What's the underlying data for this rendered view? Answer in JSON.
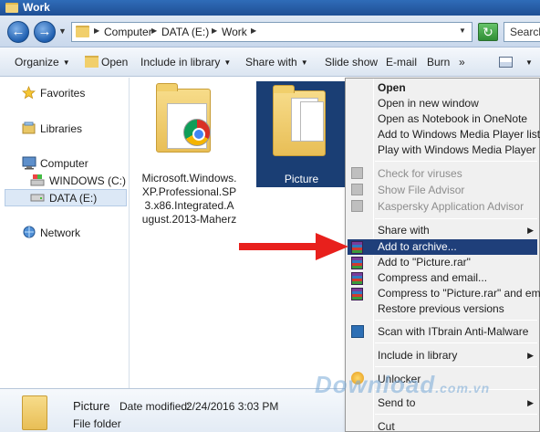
{
  "window": {
    "title": "Work"
  },
  "address_bar": {
    "breadcrumbs": [
      "Computer",
      "DATA (E:)",
      "Work"
    ],
    "search_placeholder": "Search"
  },
  "command_bar": {
    "items": [
      "Organize",
      "Open",
      "Include in library",
      "Share with",
      "Slide show",
      "E-mail",
      "Burn"
    ],
    "overflow": "»"
  },
  "nav_pane": {
    "favorites": "Favorites",
    "libraries": "Libraries",
    "computer": "Computer",
    "drive_c": "WINDOWS (C:)",
    "drive_e": "DATA (E:)",
    "network": "Network"
  },
  "files": [
    {
      "name_lines": [
        "Microsoft.Windows.",
        "XP.Professional.SP",
        "3.x86.Integrated.A",
        "ugust.2013-Maherz"
      ]
    },
    {
      "name": "Picture"
    }
  ],
  "context_menu": {
    "items": [
      {
        "label": "Open",
        "bold": true
      },
      {
        "label": "Open in new window"
      },
      {
        "label": "Open as Notebook in OneNote"
      },
      {
        "label": "Add to Windows Media Player list"
      },
      {
        "label": "Play with Windows Media Player"
      },
      {
        "label": "Check for viruses",
        "disabled": true
      },
      {
        "label": "Show File Advisor",
        "disabled": true
      },
      {
        "label": "Kaspersky Application Advisor",
        "disabled": true
      },
      {
        "label": "Share with",
        "submenu": true
      },
      {
        "label": "Add to archive...",
        "highlighted": true
      },
      {
        "label": "Add to \"Picture.rar\""
      },
      {
        "label": "Compress and email..."
      },
      {
        "label": "Compress to \"Picture.rar\" and email"
      },
      {
        "label": "Restore previous versions"
      },
      {
        "label": "Scan with ITbrain Anti-Malware"
      },
      {
        "label": "Include in library",
        "submenu": true
      },
      {
        "label": "Unlocker"
      },
      {
        "label": "Send to",
        "submenu": true
      },
      {
        "label": "Cut"
      }
    ]
  },
  "details_pane": {
    "name": "Picture",
    "modified_label": "Date modified:",
    "modified_value": "2/24/2016 3:03 PM",
    "type": "File folder"
  },
  "watermark": {
    "main": "Download",
    "suffix": ".com.vn"
  },
  "colors": {
    "highlight": "#1f3f7a",
    "arrow": "#e8201c",
    "titlebar": "#2f6cb8"
  }
}
